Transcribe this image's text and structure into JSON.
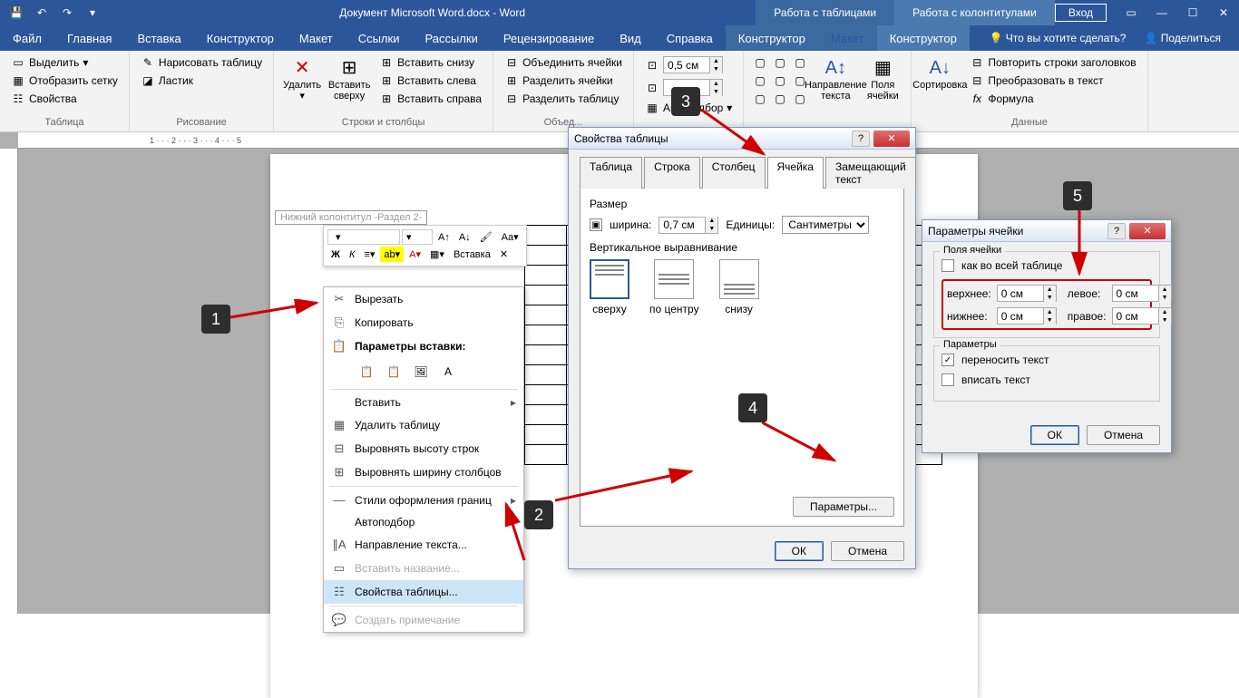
{
  "titlebar": {
    "title": "Документ Microsoft Word.docx - Word",
    "context_tab_table": "Работа с таблицами",
    "context_tab_hf": "Работа с колонтитулами",
    "login": "Вход"
  },
  "ribbon_tabs": {
    "file": "Файл",
    "home": "Главная",
    "insert": "Вставка",
    "design": "Конструктор",
    "layout": "Макет",
    "references": "Ссылки",
    "mailings": "Рассылки",
    "review": "Рецензирование",
    "view": "Вид",
    "help": "Справка",
    "tbl_design": "Конструктор",
    "tbl_layout": "Макет",
    "hf_design": "Конструктор",
    "tell_me": "Что вы хотите сделать?",
    "share": "Поделиться"
  },
  "ribbon": {
    "g_table": "Таблица",
    "select": "Выделить",
    "gridlines": "Отобразить сетку",
    "properties": "Свойства",
    "g_draw": "Рисование",
    "draw_table": "Нарисовать таблицу",
    "eraser": "Ластик",
    "g_rowscols": "Строки и столбцы",
    "delete": "Удалить",
    "insert_above": "Вставить сверху",
    "insert_below": "Вставить снизу",
    "insert_left": "Вставить слева",
    "insert_right": "Вставить справа",
    "g_merge": "Объед...",
    "merge_cells": "Объединить ячейки",
    "split_cells": "Разделить ячейки",
    "split_table": "Разделить таблицу",
    "g_cellsize": "",
    "height_val": "0,5 см",
    "autofit": "Автоподбор",
    "g_align": "",
    "text_dir": "Направление текста",
    "cell_margins": "Поля ячейки",
    "g_data": "Данные",
    "sort": "Сортировка",
    "repeat_hdr": "Повторить строки заголовков",
    "to_text": "Преобразовать в текст",
    "formula": "Формула"
  },
  "doc": {
    "footer_label": "Нижний колонтитул -Раздел 2-"
  },
  "mini": {
    "font": "",
    "insert": "Вставка"
  },
  "context_menu": {
    "cut": "Вырезать",
    "copy": "Копировать",
    "paste_options": "Параметры вставки:",
    "insert": "Вставить",
    "delete_table": "Удалить таблицу",
    "distribute_rows": "Выровнять высоту строк",
    "distribute_cols": "Выровнять ширину столбцов",
    "border_styles": "Стили оформления границ",
    "autofit": "Автоподбор",
    "text_direction": "Направление текста...",
    "insert_caption": "Вставить название...",
    "table_properties": "Свойства таблицы...",
    "new_comment": "Создать примечание"
  },
  "dialog1": {
    "title": "Свойства таблицы",
    "tab_table": "Таблица",
    "tab_row": "Строка",
    "tab_col": "Столбец",
    "tab_cell": "Ячейка",
    "tab_alt": "Замещающий текст",
    "size_label": "Размер",
    "width_label": "ширина:",
    "width_val": "0,7 см",
    "units_label": "Единицы:",
    "units_val": "Сантиметры",
    "valign_label": "Вертикальное выравнивание",
    "align_top": "сверху",
    "align_mid": "по центру",
    "align_bot": "снизу",
    "options_btn": "Параметры...",
    "ok": "ОК",
    "cancel": "Отмена"
  },
  "dialog2": {
    "title": "Параметры ячейки",
    "margins_label": "Поля ячейки",
    "same_as_table": "как во всей таблице",
    "top": "верхнее:",
    "bottom": "нижнее:",
    "left": "левое:",
    "right": "правое:",
    "val": "0 см",
    "options_label": "Параметры",
    "wrap_text": "переносить текст",
    "fit_text": "вписать текст",
    "ok": "ОК",
    "cancel": "Отмена"
  },
  "steps": {
    "s1": "1",
    "s2": "2",
    "s3": "3",
    "s4": "4",
    "s5": "5"
  }
}
